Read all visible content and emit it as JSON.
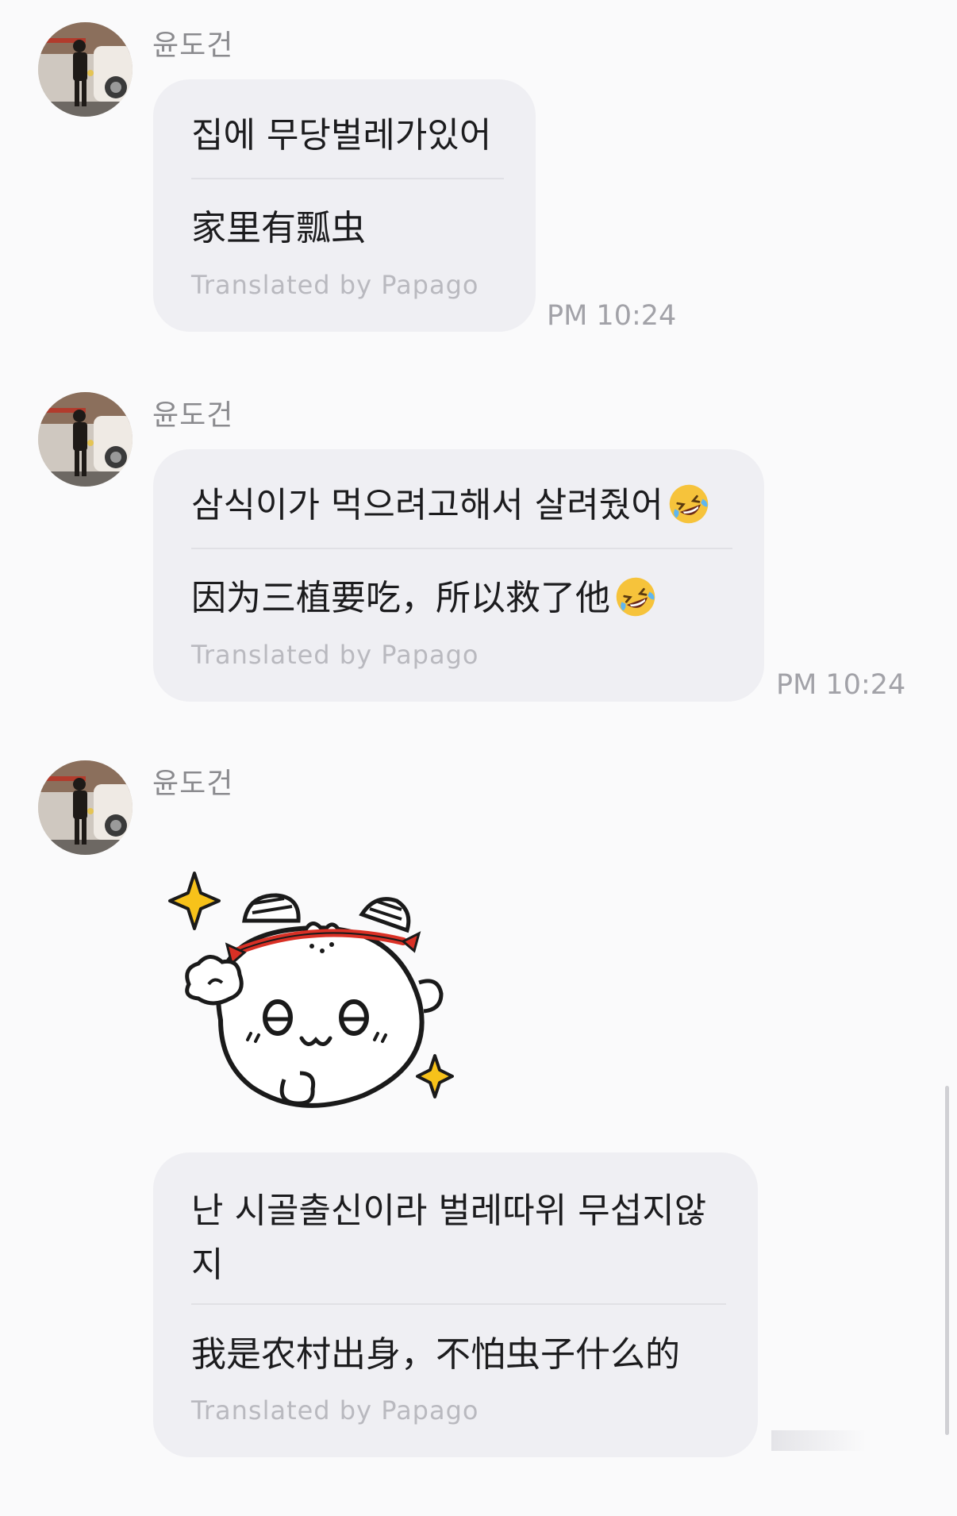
{
  "messages": [
    {
      "sender": "윤도건",
      "original": "집에 무당벌레가있어",
      "translation": "家里有瓢虫",
      "translated_by": "Translated by Papago",
      "time": "PM 10:24"
    },
    {
      "sender": "윤도건",
      "original": "삼식이가 먹으려고해서 살려줬어",
      "original_emoji": "rolling-on-floor-laughing-emoji",
      "translation": "因为三植要吃，所以救了他",
      "translation_emoji": "rolling-on-floor-laughing-emoji",
      "translated_by": "Translated by Papago",
      "time": "PM 10:24"
    },
    {
      "sender": "윤도건",
      "sticker": "cartoon-creature-sticker",
      "original": "난 시골출신이라 벌레따위 무섭지않지",
      "translation": "我是农村出身，不怕虫子什么的",
      "translated_by": "Translated by Papago"
    }
  ],
  "colors": {
    "background": "#fafafb",
    "bubble": "#efeff3",
    "sender_name": "#8a8a8e",
    "message_text": "#1c1c1e",
    "papago_text": "#b9b9bf",
    "timestamp": "#a2a2a8",
    "emoji_yellow": "#f6c33b",
    "sticker_red": "#d93025",
    "sparkle_yellow": "#f7c21a"
  }
}
